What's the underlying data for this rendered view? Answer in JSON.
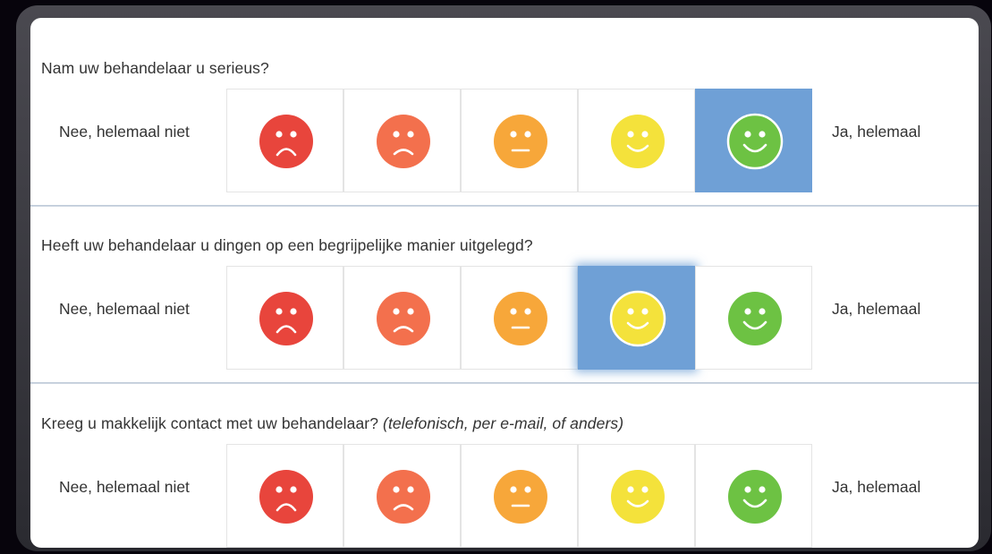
{
  "questions": [
    {
      "title": "Nam uw behandelaar u serieus?",
      "hint": "",
      "left_label": "Nee, helemaal niet",
      "right_label": "Ja, helemaal",
      "selected": 5
    },
    {
      "title": "Heeft uw behandelaar u dingen op een begrijpelijke manier uitgelegd?",
      "hint": "",
      "left_label": "Nee, helemaal niet",
      "right_label": "Ja, helemaal",
      "selected": 4
    },
    {
      "title": "Kreeg u makkelijk contact met uw behandelaar?",
      "hint": "(telefonisch, per e-mail, of anders)",
      "left_label": "Nee, helemaal niet",
      "right_label": "Ja, helemaal",
      "selected": 0
    }
  ],
  "faces": [
    {
      "icon": "very-sad-face-icon",
      "color": "#e8453c"
    },
    {
      "icon": "sad-face-icon",
      "color": "#f3704d"
    },
    {
      "icon": "neutral-face-icon",
      "color": "#f7a73a"
    },
    {
      "icon": "smile-face-icon",
      "color": "#f4e23b"
    },
    {
      "icon": "happy-face-icon",
      "color": "#6dc243"
    }
  ],
  "colors": {
    "selected_bg": "#6fa0d6",
    "separator": "#c3cdd9"
  }
}
